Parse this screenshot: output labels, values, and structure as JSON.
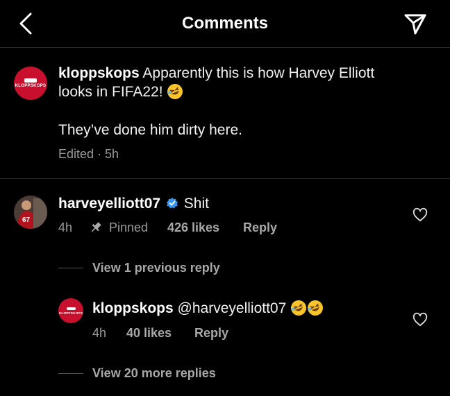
{
  "header": {
    "title": "Comments"
  },
  "caption": {
    "avatar_text": "KLOPPSKOPS",
    "username": "kloppskops",
    "text_line1": " Apparently this is how Harvey Elliott",
    "text_line2": "looks in FIFA22! ",
    "text_line3": "They’ve done him dirty here.",
    "meta": "Edited · 5h"
  },
  "comment": {
    "username": "harveyelliott07",
    "text": "Shit",
    "time": "4h",
    "pinned": "Pinned",
    "likes": "426 likes",
    "reply": "Reply",
    "jersey_number": "67"
  },
  "view_previous": "View 1 previous reply",
  "reply": {
    "avatar_text": "KLOPPSKOPS",
    "username": "kloppskops",
    "text": "@harveyelliott07 ",
    "time": "4h",
    "likes": "40 likes",
    "reply": "Reply"
  },
  "view_more": "View 20 more replies",
  "colors": {
    "background": "#000000",
    "verified": "#3897f0",
    "brand_red": "#c8102e"
  }
}
